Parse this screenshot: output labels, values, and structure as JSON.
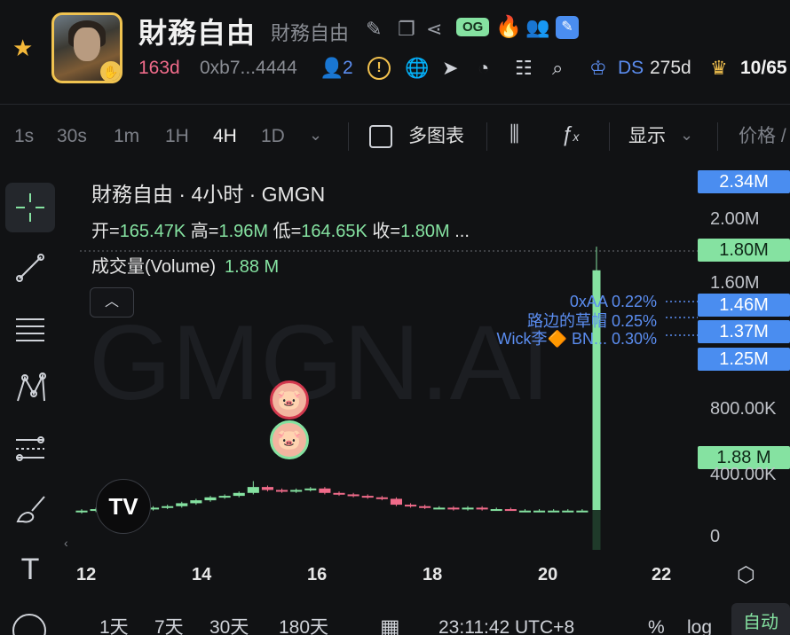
{
  "header": {
    "token_name": "財務自由",
    "token_subname": "財務自由",
    "og_badge": "OG",
    "age": "163d",
    "address": "0xb7...4444",
    "holders_count": "2",
    "dex": "DS",
    "dex_age": "275d",
    "top10": "10/65"
  },
  "toolbar": {
    "timeframes": [
      "1s",
      "30s",
      "1m",
      "1H",
      "4H",
      "1D"
    ],
    "active_timeframe": "4H",
    "multi_chart_label": "多图表",
    "display_label": "显示",
    "price_label": "价格 /"
  },
  "legend": {
    "title": "財務自由 · 4小时 · GMGN",
    "open_label": "开=",
    "open": "165.47K",
    "high_label": "高=",
    "high": "1.96M",
    "low_label": "低=",
    "low": "164.65K",
    "close_label": "收=",
    "close": "1.80M",
    "more": "...",
    "volume_label": "成交量(Volume)",
    "volume": "1.88 M"
  },
  "watermark": "GMGN.AI",
  "annotations": [
    {
      "text": "0xAA 0.22%"
    },
    {
      "text": "路边的草帽 0.25%"
    },
    {
      "text": "Wick李🔶 BN... 0.30%"
    }
  ],
  "price_labels": {
    "top": "2.34M",
    "current": "1.80M",
    "a1": "1.46M",
    "a2": "1.37M",
    "a3": "1.25M",
    "volume": "1.88 M"
  },
  "axis_ticks": [
    "2.00M",
    "1.60M",
    "800.00K",
    "400.00K",
    "0"
  ],
  "x_ticks": [
    "12",
    "14",
    "16",
    "18",
    "20",
    "22"
  ],
  "bottom_bar": {
    "ranges": [
      "1天",
      "7天",
      "30天",
      "180天"
    ],
    "time": "23:11:42 UTC+8",
    "percent": "%",
    "log": "log",
    "auto": "自动"
  },
  "colors": {
    "up": "#85e2a1",
    "down": "#f06b8a",
    "accent": "#4a8df0"
  },
  "chart_data": {
    "type": "candlestick",
    "ohlc": [
      {
        "o": 0.16,
        "h": 0.18,
        "l": 0.15,
        "c": 0.17
      },
      {
        "o": 0.17,
        "h": 0.19,
        "l": 0.16,
        "c": 0.18
      },
      {
        "o": 0.18,
        "h": 0.19,
        "l": 0.17,
        "c": 0.17
      },
      {
        "o": 0.17,
        "h": 0.18,
        "l": 0.16,
        "c": 0.17
      },
      {
        "o": 0.17,
        "h": 0.19,
        "l": 0.17,
        "c": 0.18
      },
      {
        "o": 0.18,
        "h": 0.2,
        "l": 0.17,
        "c": 0.19
      },
      {
        "o": 0.19,
        "h": 0.21,
        "l": 0.18,
        "c": 0.2
      },
      {
        "o": 0.2,
        "h": 0.23,
        "l": 0.19,
        "c": 0.22
      },
      {
        "o": 0.22,
        "h": 0.25,
        "l": 0.21,
        "c": 0.24
      },
      {
        "o": 0.24,
        "h": 0.27,
        "l": 0.23,
        "c": 0.26
      },
      {
        "o": 0.26,
        "h": 0.28,
        "l": 0.25,
        "c": 0.27
      },
      {
        "o": 0.27,
        "h": 0.3,
        "l": 0.26,
        "c": 0.29
      },
      {
        "o": 0.29,
        "h": 0.37,
        "l": 0.28,
        "c": 0.33
      },
      {
        "o": 0.33,
        "h": 0.34,
        "l": 0.3,
        "c": 0.31
      },
      {
        "o": 0.31,
        "h": 0.32,
        "l": 0.29,
        "c": 0.3
      },
      {
        "o": 0.3,
        "h": 0.32,
        "l": 0.29,
        "c": 0.31
      },
      {
        "o": 0.31,
        "h": 0.33,
        "l": 0.3,
        "c": 0.32
      },
      {
        "o": 0.32,
        "h": 0.33,
        "l": 0.28,
        "c": 0.29
      },
      {
        "o": 0.29,
        "h": 0.3,
        "l": 0.27,
        "c": 0.28
      },
      {
        "o": 0.28,
        "h": 0.29,
        "l": 0.26,
        "c": 0.27
      },
      {
        "o": 0.27,
        "h": 0.28,
        "l": 0.25,
        "c": 0.26
      },
      {
        "o": 0.26,
        "h": 0.27,
        "l": 0.24,
        "c": 0.25
      },
      {
        "o": 0.25,
        "h": 0.26,
        "l": 0.2,
        "c": 0.21
      },
      {
        "o": 0.21,
        "h": 0.22,
        "l": 0.19,
        "c": 0.2
      },
      {
        "o": 0.2,
        "h": 0.21,
        "l": 0.18,
        "c": 0.19
      },
      {
        "o": 0.19,
        "h": 0.2,
        "l": 0.18,
        "c": 0.19
      },
      {
        "o": 0.19,
        "h": 0.2,
        "l": 0.17,
        "c": 0.18
      },
      {
        "o": 0.18,
        "h": 0.2,
        "l": 0.17,
        "c": 0.19
      },
      {
        "o": 0.19,
        "h": 0.2,
        "l": 0.17,
        "c": 0.18
      },
      {
        "o": 0.18,
        "h": 0.19,
        "l": 0.17,
        "c": 0.18
      },
      {
        "o": 0.18,
        "h": 0.19,
        "l": 0.17,
        "c": 0.17
      },
      {
        "o": 0.17,
        "h": 0.18,
        "l": 0.16,
        "c": 0.17
      },
      {
        "o": 0.17,
        "h": 0.18,
        "l": 0.16,
        "c": 0.17
      },
      {
        "o": 0.17,
        "h": 0.18,
        "l": 0.16,
        "c": 0.17
      },
      {
        "o": 0.17,
        "h": 0.18,
        "l": 0.16,
        "c": 0.17
      },
      {
        "o": 0.17,
        "h": 0.18,
        "l": 0.16,
        "c": 0.17
      },
      {
        "o": 0.165,
        "h": 1.96,
        "l": 0.165,
        "c": 1.8
      }
    ],
    "volume": 1.88,
    "x_ticks": [
      "12",
      "14",
      "16",
      "18",
      "20",
      "22"
    ],
    "y_ticks": [
      "2.00M",
      "1.60M",
      "800.00K",
      "400.00K",
      "0"
    ],
    "ylim": [
      0,
      2.4
    ]
  }
}
